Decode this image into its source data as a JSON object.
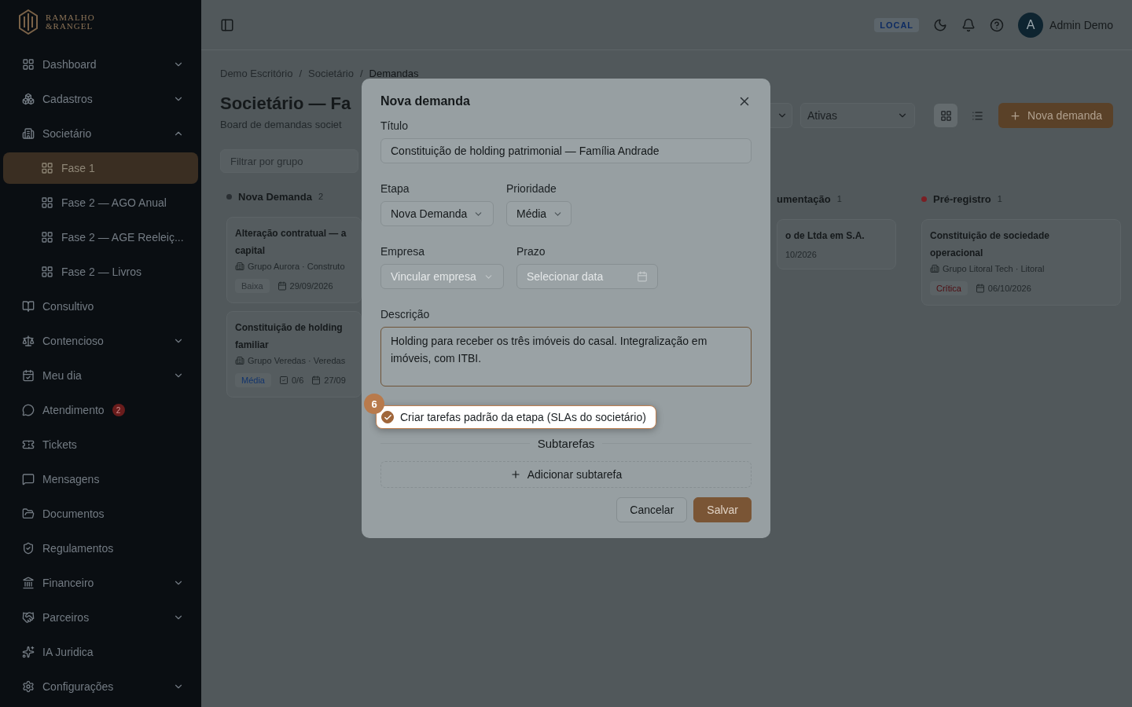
{
  "sidebar": {
    "logo": {
      "line1": "RAMALHO",
      "line2": "&RANGEL"
    },
    "items": [
      {
        "label": "Dashboard",
        "expanded": false
      },
      {
        "label": "Cadastros",
        "expanded": false
      },
      {
        "label": "Societário",
        "expanded": true,
        "children": [
          {
            "label": "Fase 1",
            "selected": true
          },
          {
            "label": "Fase 2 — AGO Anual",
            "selected": false
          },
          {
            "label": "Fase 2 — AGE Reeleiç...",
            "selected": false
          },
          {
            "label": "Fase 2 — Livros",
            "selected": false
          }
        ]
      },
      {
        "label": "Consultivo"
      },
      {
        "label": "Contencioso",
        "expanded": false
      },
      {
        "label": "Meu dia",
        "expanded": false
      },
      {
        "label": "Atendimento",
        "badge": "2"
      },
      {
        "label": "Tickets"
      },
      {
        "label": "Mensagens"
      },
      {
        "label": "Documentos"
      },
      {
        "label": "Regulamentos"
      },
      {
        "label": "Financeiro",
        "expanded": false
      },
      {
        "label": "Parceiros",
        "expanded": false
      },
      {
        "label": "IA Juridica"
      },
      {
        "label": "Configurações",
        "expanded": false
      }
    ]
  },
  "topbar": {
    "env": "LOCAL",
    "user": {
      "initial": "A",
      "name": "Admin Demo"
    }
  },
  "page": {
    "breadcrumb": [
      "Demo Escritório",
      "Societário",
      "Demandas"
    ],
    "breadcrumb_separator": "/",
    "title": "Societário — Fa",
    "subtitle": "Board de demandas societ",
    "filter": {
      "placeholder": "Filtrar por grupo"
    },
    "status": "Ativas",
    "view_modes": [
      {
        "selected": true
      },
      {
        "selected": false
      }
    ],
    "new_button": "Nova demanda"
  },
  "columns_left": [
    {
      "title": "Nova Demanda",
      "count": "2",
      "color": "#2a2f33",
      "cards": [
        {
          "title_lines": [
            "Alteração contratual — a",
            "capital"
          ],
          "company": "Grupo Aurora · Construto",
          "priority": {
            "label": "Baixa",
            "color": "#2e3438"
          },
          "due": "29/09/2026"
        },
        {
          "title_lines": [
            "Constituição de holding",
            "familiar"
          ],
          "company": "Grupo Veredas · Veredas",
          "priority": {
            "label": "Média",
            "color": "#12346c"
          },
          "tasks": "0/6",
          "due": "27/09"
        }
      ]
    }
  ],
  "columns_right": [
    {
      "title": "umentação",
      "count": "1",
      "cards": [
        {
          "title_lines": [
            "o de Ltda em S.A."
          ],
          "due": "10/2026"
        }
      ]
    },
    {
      "title": "Pré-registro",
      "count": "1",
      "color": "#7a1f24",
      "cards": [
        {
          "title_lines": [
            "Constituição de sociedade",
            "operacional"
          ],
          "company": "Grupo Litoral Tech · Litoral",
          "priority": {
            "label": "Crítica",
            "color": "#4e0c10"
          },
          "due": "06/10/2026"
        }
      ]
    }
  ],
  "modal": {
    "title": "Nova demanda",
    "titulo": {
      "label": "Título",
      "value": "Constituição de holding patrimonial — Família Andrade"
    },
    "etapa": {
      "label": "Etapa",
      "value": "Nova Demanda"
    },
    "prioridade": {
      "label": "Prioridade",
      "value": "Média"
    },
    "empresa": {
      "label": "Empresa",
      "placeholder": "Vincular empresa"
    },
    "prazo": {
      "label": "Prazo",
      "placeholder": "Selecionar data"
    },
    "descricao": {
      "label": "Descrição",
      "value": "Holding para receber os três imóveis do casal. Integralização em imóveis, com ITBI."
    },
    "checkbox": {
      "label": "Criar tarefas padrão da etapa (SLAs do societário)",
      "checked": true,
      "step": "6"
    },
    "subtasks": {
      "heading": "Subtarefas",
      "add": "Adicionar subtarefa"
    },
    "buttons": {
      "cancel": "Cancelar",
      "save": "Salvar"
    }
  }
}
